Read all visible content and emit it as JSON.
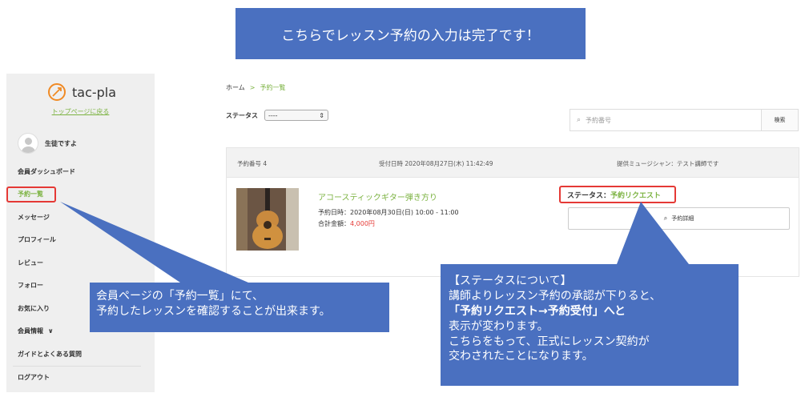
{
  "banner": {
    "text": "こちらでレッスン予約の入力は完了です！"
  },
  "sidebar": {
    "logo_text": "tac-pla",
    "top_link": "トップページに戻る",
    "user_name": "生徒ですよ",
    "items": [
      {
        "label": "会員ダッシュボード"
      },
      {
        "label": "予約一覧"
      },
      {
        "label": "メッセージ"
      },
      {
        "label": "プロフィール"
      },
      {
        "label": "レビュー"
      },
      {
        "label": "フォロー"
      },
      {
        "label": "お気に入り"
      },
      {
        "label": "会員情報"
      },
      {
        "label": "ガイドとよくある質問"
      },
      {
        "label": "ログアウト"
      }
    ],
    "chevron": "∨"
  },
  "breadcrumb": {
    "home": "ホーム",
    "separator": ">",
    "current": "予約一覧"
  },
  "filter": {
    "label": "ステータス",
    "selected": "----"
  },
  "search": {
    "placeholder": "予約番号",
    "button": "検索"
  },
  "reservation": {
    "number": "予約番号 4",
    "received": "受付日時 2020年08月27日(木) 11:42:49",
    "musician": "提供ミュージシャン：テスト講師です",
    "title": "アコースティックギター弾き方り",
    "date": "予約日時：2020年08月30日(日) 10:00 - 11:00",
    "price_label": "合計金額：",
    "price": "4,000円",
    "status_label": "ステータス：",
    "status": "予約リクエスト",
    "detail_button": "予約詳細"
  },
  "notes": {
    "note1_line1": "会員ページの「予約一覧」にて、",
    "note1_line2": "予約したレッスンを確認することが出来ます。",
    "note2_line1": "【ステータスについて】",
    "note2_line2": "講師よりレッスン予約の承認が下りると、",
    "note2_line3": "「予約リクエスト→予約受付」へと",
    "note2_line4": "表示が変わります。",
    "note2_line5": "こちらをもって、正式にレッスン契約が",
    "note2_line6": "交わされたことになります。"
  },
  "colors": {
    "accent": "#7cb342",
    "callout": "#4a70c0",
    "highlight": "#e53935"
  }
}
